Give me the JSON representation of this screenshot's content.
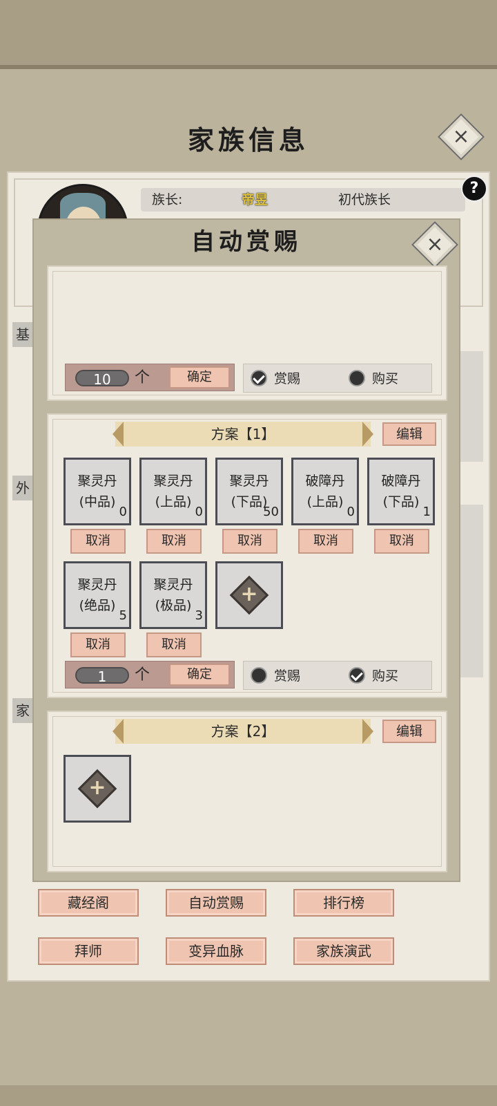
{
  "page": {
    "title": "家族信息"
  },
  "leader": {
    "label": "族长:",
    "name": "帝昱",
    "role": "初代族长"
  },
  "side_labels": [
    "基",
    "外",
    "家"
  ],
  "bottom_buttons": [
    "藏经阁",
    "自动赏赐",
    "排行榜",
    "拜师",
    "变异血脉",
    "家族演武"
  ],
  "dialog": {
    "title": "自动赏赐",
    "top_section": {
      "quantity": "10",
      "unit": "个",
      "confirm": "确定",
      "options": [
        {
          "label": "赏赐",
          "checked": true
        },
        {
          "label": "购买",
          "checked": false
        }
      ]
    },
    "plans": [
      {
        "name": "方案【1】",
        "edit": "编辑",
        "items": [
          {
            "line1": "聚灵丹",
            "line2": "(中品)",
            "count": "0"
          },
          {
            "line1": "聚灵丹",
            "line2": "(上品)",
            "count": "0"
          },
          {
            "line1": "聚灵丹",
            "line2": "(下品)",
            "count": "50"
          },
          {
            "line1": "破障丹",
            "line2": "(上品)",
            "count": "0"
          },
          {
            "line1": "破障丹",
            "line2": "(下品)",
            "count": "1"
          },
          {
            "line1": "聚灵丹",
            "line2": "(绝品)",
            "count": "5"
          },
          {
            "line1": "聚灵丹",
            "line2": "(极品)",
            "count": "3"
          }
        ],
        "cancel": "取消",
        "quantity": "1",
        "unit": "个",
        "confirm": "确定",
        "options": [
          {
            "label": "赏赐",
            "checked": false
          },
          {
            "label": "购买",
            "checked": true
          }
        ]
      },
      {
        "name": "方案【2】",
        "edit": "编辑"
      }
    ]
  },
  "icons": {
    "close": "close-icon",
    "help": "help-icon",
    "add": "plus-icon"
  }
}
